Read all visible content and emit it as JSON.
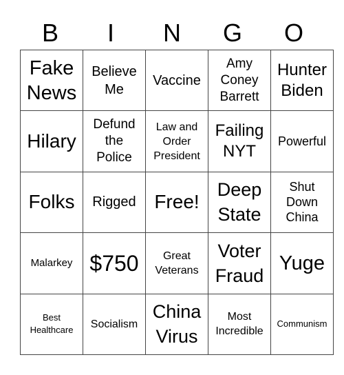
{
  "header": {
    "letters": [
      "B",
      "I",
      "N",
      "G",
      "O"
    ]
  },
  "card": {
    "rows": [
      [
        "Fake\nNews",
        "Believe\nMe",
        "Vaccine",
        "Amy\nConey\nBarrett",
        "Hunter\nBiden"
      ],
      [
        "Hilary",
        "Defund\nthe\nPolice",
        "Law and\nOrder\nPresident",
        "Failing\nNYT",
        "Powerful"
      ],
      [
        "Folks",
        "Rigged",
        "Free!",
        "Deep\nState",
        "Shut\nDown\nChina"
      ],
      [
        "Malarkey",
        "$750",
        "Great\nVeterans",
        "Voter\nFraud",
        "Yuge"
      ],
      [
        "Best\nHealthcare",
        "Socialism",
        "China\nVirus",
        "Most\nIncredible",
        "Communism"
      ]
    ]
  }
}
